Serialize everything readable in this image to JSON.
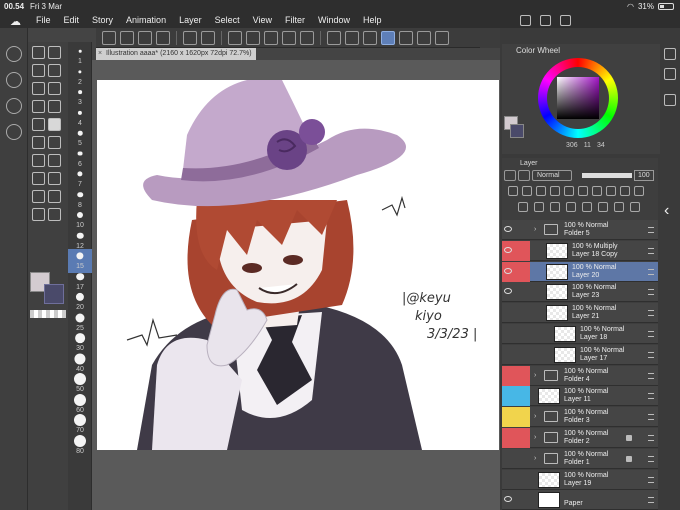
{
  "status": {
    "time": "00.54",
    "date": "Fri 3 Mar",
    "battery": "31%",
    "battery_level": 0.31
  },
  "menu": [
    "File",
    "Edit",
    "Story",
    "Animation",
    "Layer",
    "Select",
    "View",
    "Filter",
    "Window",
    "Help"
  ],
  "canvas_tab": {
    "title": "Illustration aaaa* (2160 x 1620px 72dpi 72.7%)"
  },
  "brush_sizes": [
    "1",
    "2",
    "3",
    "4",
    "5",
    "6",
    "7",
    "8",
    "10",
    "12",
    "15",
    "17",
    "20",
    "25",
    "30",
    "40",
    "50",
    "60",
    "70",
    "80"
  ],
  "active_brush_size": "15",
  "colors": {
    "main": "#d3cbd0",
    "sub": "#4a4a6a",
    "accent": "#5e77a6"
  },
  "color_wheel": {
    "title": "Color Wheel",
    "h": "306",
    "s": "11",
    "v": "34"
  },
  "layer_panel": {
    "title": "Layer",
    "blend_mode": "Normal",
    "opacity": "100",
    "layers": [
      {
        "line1": "100 % Normal",
        "line2": "Folder 5",
        "type": "folder",
        "indent": 0,
        "color": "",
        "visible": true
      },
      {
        "line1": "100 % Multiply",
        "line2": "Layer 18 Copy",
        "type": "layer",
        "indent": 1,
        "color": "#e0555a",
        "visible": true
      },
      {
        "line1": "100 % Normal",
        "line2": "Layer 20",
        "type": "layer",
        "indent": 1,
        "color": "#e0555a",
        "visible": true,
        "selected": true
      },
      {
        "line1": "100 % Normal",
        "line2": "Layer 23",
        "type": "layer",
        "indent": 1,
        "color": "",
        "visible": true
      },
      {
        "line1": "100 % Normal",
        "line2": "Layer 21",
        "type": "layer",
        "indent": 1,
        "color": "",
        "visible": false
      },
      {
        "line1": "100 % Normal",
        "line2": "Layer 18",
        "type": "layer",
        "indent": 2,
        "color": "",
        "visible": false
      },
      {
        "line1": "100 % Normal",
        "line2": "Layer 17",
        "type": "layer",
        "indent": 2,
        "color": "",
        "visible": false
      },
      {
        "line1": "100 % Normal",
        "line2": "Folder 4",
        "type": "folder",
        "indent": 0,
        "color": "#e0555a",
        "visible": false
      },
      {
        "line1": "100 % Normal",
        "line2": "Layer 11",
        "type": "layer",
        "indent": 0,
        "color": "#47b7e6",
        "visible": false
      },
      {
        "line1": "100 % Normal",
        "line2": "Folder 3",
        "type": "folder",
        "indent": 0,
        "color": "#f1d44c",
        "visible": false
      },
      {
        "line1": "100 % Normal",
        "line2": "Folder 2",
        "type": "folder",
        "indent": 0,
        "color": "#e0555a",
        "visible": false,
        "locked": true
      },
      {
        "line1": "100 % Normal",
        "line2": "Folder 1",
        "type": "folder",
        "indent": 0,
        "color": "",
        "visible": false,
        "locked": true
      },
      {
        "line1": "100 % Normal",
        "line2": "Layer 19",
        "type": "layer",
        "indent": 0,
        "color": "",
        "visible": false
      },
      {
        "line1": "",
        "line2": "Paper",
        "type": "paper",
        "indent": 0,
        "color": "",
        "visible": true
      }
    ]
  },
  "artwork": {
    "signature": "@keyu kiyo 3/3/23",
    "hat": "#b89bc0",
    "rose": "#6a4386",
    "hair": "#a8442f",
    "suit": "#3f3a47"
  }
}
